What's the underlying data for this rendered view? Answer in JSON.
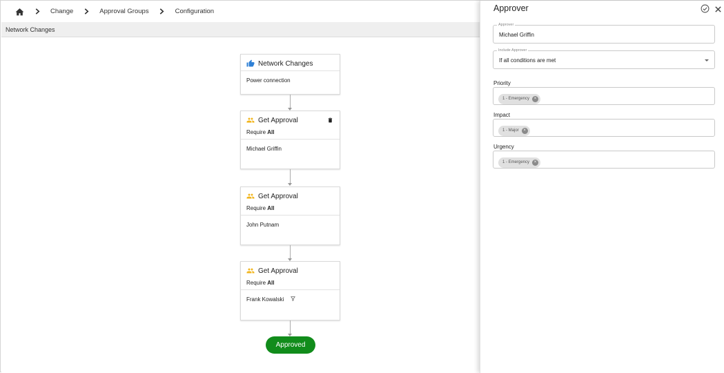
{
  "breadcrumb": {
    "home_icon": "home-icon",
    "items": [
      {
        "label": "Change"
      },
      {
        "label": "Approval Groups"
      },
      {
        "label": "Configuration"
      }
    ]
  },
  "subheader": {
    "title": "Network Changes"
  },
  "flow": {
    "start_card": {
      "icon": "thumbs-up-icon",
      "title": "Network Changes",
      "detail": "Power connection"
    },
    "approval_cards": [
      {
        "icon": "group-icon",
        "title": "Get Approval",
        "require_prefix": "Require",
        "require_value": "All",
        "approver": "Michael Griffin",
        "has_delete": true
      },
      {
        "icon": "group-icon",
        "title": "Get Approval",
        "require_prefix": "Require",
        "require_value": "All",
        "approver": "John Putnam"
      },
      {
        "icon": "group-icon",
        "title": "Get Approval",
        "require_prefix": "Require",
        "require_value": "All",
        "approver": "Frank Kowalski",
        "has_filter": true
      }
    ],
    "end_label": "Approved"
  },
  "panel": {
    "title": "Approver",
    "approver_field": {
      "label": "Approver",
      "value": "Michael Griffin"
    },
    "include_field": {
      "label": "Include Approver",
      "value": "If all conditions are met"
    },
    "priority": {
      "label": "Priority",
      "chips": [
        "1 - Emergency"
      ]
    },
    "impact": {
      "label": "Impact",
      "chips": [
        "1 - Major"
      ]
    },
    "urgency": {
      "label": "Urgency",
      "chips": [
        "1 - Emergency"
      ]
    }
  },
  "colors": {
    "approved_green": "#118c1b",
    "thumb_blue": "#2f80d6",
    "group_yellow": "#f2b51c"
  }
}
